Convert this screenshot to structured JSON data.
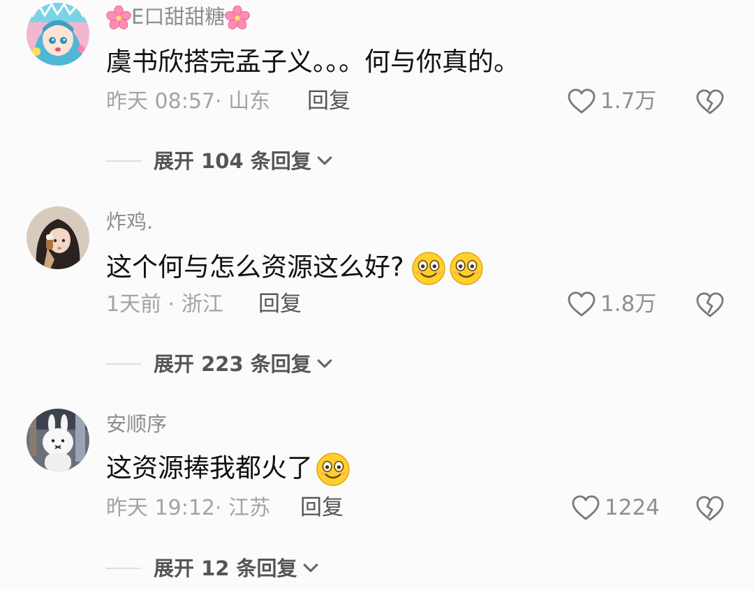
{
  "comments": [
    {
      "username": "E口甜甜糖",
      "text": "虞书欣搭完孟子义。。。何与你真的。",
      "meta": "昨天 08:57· 山东",
      "reply_label": "回复",
      "likes": "1.7万",
      "expand_label": "展开 104 条回复"
    },
    {
      "username": "炸鸡.",
      "text": "这个何与怎么资源这么好?",
      "meta": "1天前 · 浙江",
      "reply_label": "回复",
      "likes": "1.8万",
      "expand_label": "展开 223 条回复"
    },
    {
      "username": "安顺序",
      "text": "这资源捧我都火了",
      "meta": "昨天 19:12· 江苏",
      "reply_label": "回复",
      "likes": "1224",
      "expand_label": "展开 12 条回复"
    }
  ],
  "icons": {
    "like": "heart-outline-icon",
    "dislike": "broken-heart-icon",
    "emoji": "grinning-face-emoji",
    "username_decoration": "cherry-blossom-icon",
    "expand": "chevron-down-icon"
  },
  "colors": {
    "background": "#fbfbfb",
    "text": "#111111",
    "muted": "#a3a3a3",
    "username": "#8d8d8d",
    "emoji_face": "#ffd02b",
    "blossom": "#ff8cb4"
  }
}
